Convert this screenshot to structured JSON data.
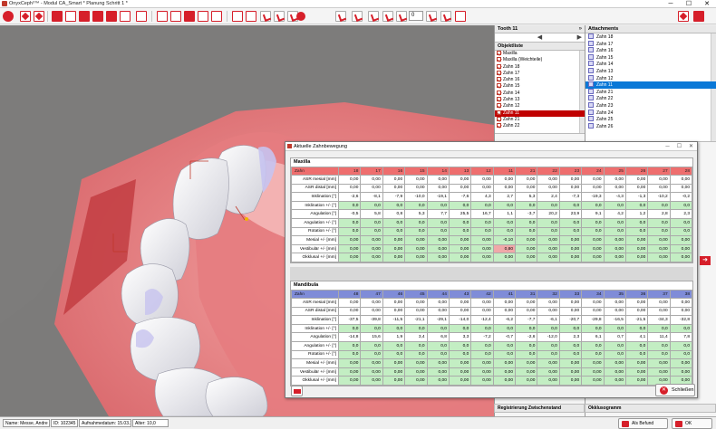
{
  "window": {
    "title": "OnyxCeph³™ - Modul CA_Smart   * Planung Schritt 1 *",
    "minimize": "─",
    "maximize": "☐",
    "close": "✕"
  },
  "toolbar": {
    "step_value": "0"
  },
  "tooth_panel": {
    "title": "Tooth 11",
    "prev": "◀",
    "next": "▶"
  },
  "object_list": {
    "title": "Objektliste",
    "items": [
      {
        "label": "Maxilla",
        "checked": true
      },
      {
        "label": "Maxilla (Weichteile)",
        "checked": true
      },
      {
        "label": "Zahn 18",
        "checked": true
      },
      {
        "label": "Zahn 17",
        "checked": true
      },
      {
        "label": "Zahn 16",
        "checked": true
      },
      {
        "label": "Zahn 15",
        "checked": true
      },
      {
        "label": "Zahn 14",
        "checked": true
      },
      {
        "label": "Zahn 13",
        "checked": true
      },
      {
        "label": "Zahn 12",
        "checked": true
      },
      {
        "label": "Zahn 11",
        "checked": true,
        "selected": true
      },
      {
        "label": "Zahn 21",
        "checked": true
      },
      {
        "label": "Zahn 22",
        "checked": true
      }
    ]
  },
  "attachments": {
    "title": "Attachments",
    "items": [
      {
        "label": "Zahn 18"
      },
      {
        "label": "Zahn 17"
      },
      {
        "label": "Zahn 16"
      },
      {
        "label": "Zahn 15"
      },
      {
        "label": "Zahn 14"
      },
      {
        "label": "Zahn 13"
      },
      {
        "label": "Zahn 12"
      },
      {
        "label": "Zahn 11",
        "selected": true
      },
      {
        "label": "Zahn 21"
      },
      {
        "label": "Zahn 22"
      },
      {
        "label": "Zahn 23"
      },
      {
        "label": "Zahn 24"
      },
      {
        "label": "Zahn 25"
      },
      {
        "label": "Zahn 26"
      }
    ]
  },
  "dialog": {
    "title": "Aktuelle Zahnbewegung",
    "close_label": "Schließen",
    "maxilla": {
      "title": "Maxilla",
      "header_label": "Zahn",
      "teeth": [
        "18",
        "17",
        "16",
        "15",
        "14",
        "13",
        "12",
        "11",
        "21",
        "22",
        "23",
        "24",
        "25",
        "26",
        "27",
        "28"
      ],
      "rows": [
        {
          "label": "ASR mesial [mm]",
          "values": [
            "0,00",
            "0,00",
            "0,00",
            "0,00",
            "0,00",
            "0,00",
            "0,00",
            "0,00",
            "0,00",
            "0,00",
            "0,00",
            "0,00",
            "0,00",
            "0,00",
            "0,00",
            "0,00"
          ]
        },
        {
          "label": "ASR distal [mm]",
          "values": [
            "0,00",
            "0,00",
            "0,00",
            "0,00",
            "0,00",
            "0,00",
            "0,00",
            "0,00",
            "0,00",
            "0,00",
            "0,00",
            "0,00",
            "0,00",
            "0,00",
            "0,00",
            "0,00"
          ]
        },
        {
          "label": "Inklination [°]",
          "values": [
            "-2,6",
            "-8,1",
            "-7,9",
            "-10,0",
            "-19,1",
            "-7,6",
            "4,3",
            "2,7",
            "5,3",
            "2,4",
            "-7,3",
            "-19,3",
            "-4,3",
            "-1,3",
            "-10,2",
            "-0,2"
          ]
        },
        {
          "label": "Inklination +/- [°]",
          "values": [
            "0,0",
            "0,0",
            "0,0",
            "0,0",
            "0,0",
            "0,0",
            "0,0",
            "0,0",
            "0,0",
            "0,0",
            "0,0",
            "0,0",
            "0,0",
            "0,0",
            "0,0",
            "0,0"
          ]
        },
        {
          "label": "Angulation [°]",
          "values": [
            "-0,5",
            "5,8",
            "0,8",
            "5,3",
            "7,7",
            "25,5",
            "16,7",
            "1,1",
            "-3,7",
            "20,2",
            "23,9",
            "9,1",
            "4,2",
            "1,2",
            "2,8",
            "2,3"
          ]
        },
        {
          "label": "Angulation +/- [°]",
          "values": [
            "0,0",
            "0,0",
            "0,0",
            "0,0",
            "0,0",
            "0,0",
            "0,0",
            "0,0",
            "0,0",
            "0,0",
            "0,0",
            "0,0",
            "0,0",
            "0,0",
            "0,0",
            "0,0"
          ]
        },
        {
          "label": "Rotation +/- [°]",
          "values": [
            "0,0",
            "0,0",
            "0,0",
            "0,0",
            "0,0",
            "0,0",
            "0,0",
            "0,0",
            "0,0",
            "0,0",
            "0,0",
            "0,0",
            "0,0",
            "0,0",
            "0,0",
            "0,0"
          ]
        },
        {
          "label": "Mesial +/- [mm]",
          "values": [
            "0,00",
            "0,00",
            "0,00",
            "0,00",
            "0,00",
            "0,00",
            "0,00",
            "-0,10",
            "0,00",
            "0,00",
            "0,00",
            "0,00",
            "0,00",
            "0,00",
            "0,00",
            "0,00"
          ]
        },
        {
          "label": "Vestibulär +/- [mm]",
          "values": [
            "0,00",
            "0,00",
            "0,00",
            "0,00",
            "0,00",
            "0,00",
            "0,00",
            "0,80",
            "0,00",
            "0,00",
            "0,00",
            "0,00",
            "0,00",
            "0,00",
            "0,00",
            "0,00"
          ]
        },
        {
          "label": "Okklusal +/- [mm]",
          "values": [
            "0,00",
            "0,00",
            "0,00",
            "0,00",
            "0,00",
            "0,00",
            "0,00",
            "0,00",
            "0,00",
            "0,00",
            "0,00",
            "0,00",
            "0,00",
            "0,00",
            "0,00",
            "0,00"
          ]
        }
      ]
    },
    "mandibula": {
      "title": "Mandibula",
      "header_label": "Zahn",
      "teeth": [
        "48",
        "47",
        "46",
        "45",
        "44",
        "43",
        "42",
        "41",
        "31",
        "32",
        "33",
        "34",
        "35",
        "36",
        "37",
        "38"
      ],
      "rows": [
        {
          "label": "ASR mesial [mm]",
          "values": [
            "0,00",
            "0,00",
            "0,00",
            "0,00",
            "0,00",
            "0,00",
            "0,00",
            "0,00",
            "0,00",
            "0,00",
            "0,00",
            "0,00",
            "0,00",
            "0,00",
            "0,00",
            "0,00"
          ]
        },
        {
          "label": "ASR distal [mm]",
          "values": [
            "0,00",
            "0,00",
            "0,00",
            "0,00",
            "0,00",
            "0,00",
            "0,00",
            "0,00",
            "0,00",
            "0,00",
            "0,00",
            "0,00",
            "0,00",
            "0,00",
            "0,00",
            "0,00"
          ]
        },
        {
          "label": "Inklination [°]",
          "values": [
            "-37,5",
            "-39,8",
            "-11,5",
            "-21,1",
            "-29,1",
            "-14,0",
            "-12,4",
            "-6,2",
            "-7,7",
            "-6,1",
            "-20,7",
            "-29,8",
            "-16,5",
            "-21,5",
            "-34,3",
            "-32,8"
          ]
        },
        {
          "label": "Inklination +/- [°]",
          "values": [
            "0,0",
            "0,0",
            "0,0",
            "0,0",
            "0,0",
            "0,0",
            "0,0",
            "0,0",
            "0,0",
            "0,0",
            "0,0",
            "0,0",
            "0,0",
            "0,0",
            "0,0",
            "0,0"
          ]
        },
        {
          "label": "Angulation [°]",
          "values": [
            "-14,8",
            "15,6",
            "1,9",
            "3,4",
            "6,8",
            "3,3",
            "-7,2",
            "-0,7",
            "-2,6",
            "-12,0",
            "2,3",
            "6,1",
            "0,7",
            "4,1",
            "11,4",
            "7,8"
          ]
        },
        {
          "label": "Angulation +/- [°]",
          "values": [
            "0,0",
            "0,0",
            "0,0",
            "0,0",
            "0,0",
            "0,0",
            "0,0",
            "0,0",
            "0,0",
            "0,0",
            "0,0",
            "0,0",
            "0,0",
            "0,0",
            "0,0",
            "0,0"
          ]
        },
        {
          "label": "Rotation +/- [°]",
          "values": [
            "0,0",
            "0,0",
            "0,0",
            "0,0",
            "0,0",
            "0,0",
            "0,0",
            "0,0",
            "0,0",
            "0,0",
            "0,0",
            "0,0",
            "0,0",
            "0,0",
            "0,0",
            "0,0"
          ]
        },
        {
          "label": "Mesial +/- [mm]",
          "values": [
            "0,00",
            "0,00",
            "0,00",
            "0,00",
            "0,00",
            "0,00",
            "0,00",
            "0,00",
            "0,00",
            "0,00",
            "0,00",
            "0,00",
            "0,00",
            "0,00",
            "0,00",
            "0,00"
          ]
        },
        {
          "label": "Vestibulär +/- [mm]",
          "values": [
            "0,00",
            "0,00",
            "0,00",
            "0,00",
            "0,00",
            "0,00",
            "0,00",
            "0,00",
            "0,00",
            "0,00",
            "0,00",
            "0,00",
            "0,00",
            "0,00",
            "0,00",
            "0,00"
          ]
        },
        {
          "label": "Okklusal +/- [mm]",
          "values": [
            "0,00",
            "0,00",
            "0,00",
            "0,00",
            "0,00",
            "0,00",
            "0,00",
            "0,00",
            "0,00",
            "0,00",
            "0,00",
            "0,00",
            "0,00",
            "0,00",
            "0,00",
            "0,00"
          ]
        }
      ]
    }
  },
  "bottom_panels": {
    "registration": "Registrierung Zwischenstand",
    "occlusogram": "Okklusogramm"
  },
  "status": {
    "name": "Name: Messe, Andre",
    "id": "ID: 102345",
    "date": "Aufnahmedatum: 15.03.2016",
    "age": "Alter: 10,0",
    "befund_button": "Als Befund",
    "ok_button": "OK"
  }
}
